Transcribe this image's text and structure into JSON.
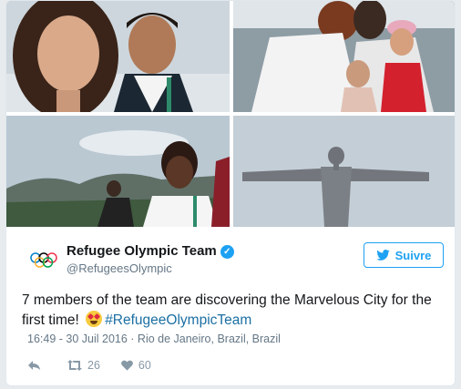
{
  "tweet": {
    "account_name": "Refugee Olympic Team",
    "handle": "@RefugeesOlympic",
    "follow_label": "Suivre",
    "text_main": "7 members of the team are discovering the Marvelous City for the first time!",
    "hashtag": "#RefugeeOlympicTeam",
    "timestamp": "16:49 - 30 Juil 2016 · Rio de Janeiro, Brazil, Brazil",
    "retweet_count": "26",
    "like_count": "60"
  },
  "media": {
    "photos": [
      "photo-1",
      "photo-2",
      "photo-3",
      "photo-4"
    ]
  },
  "icons": {
    "avatar": "olympic-rings-icon",
    "verified": "verified-badge-icon",
    "follow": "twitter-bird-icon",
    "emoji": "heart-eyes-emoji-icon",
    "reply": "reply-icon",
    "retweet": "retweet-icon",
    "like": "heart-icon"
  },
  "colors": {
    "accent": "#1da1f2",
    "hashtag": "#1b6fa3",
    "secondary_text": "#657786"
  }
}
